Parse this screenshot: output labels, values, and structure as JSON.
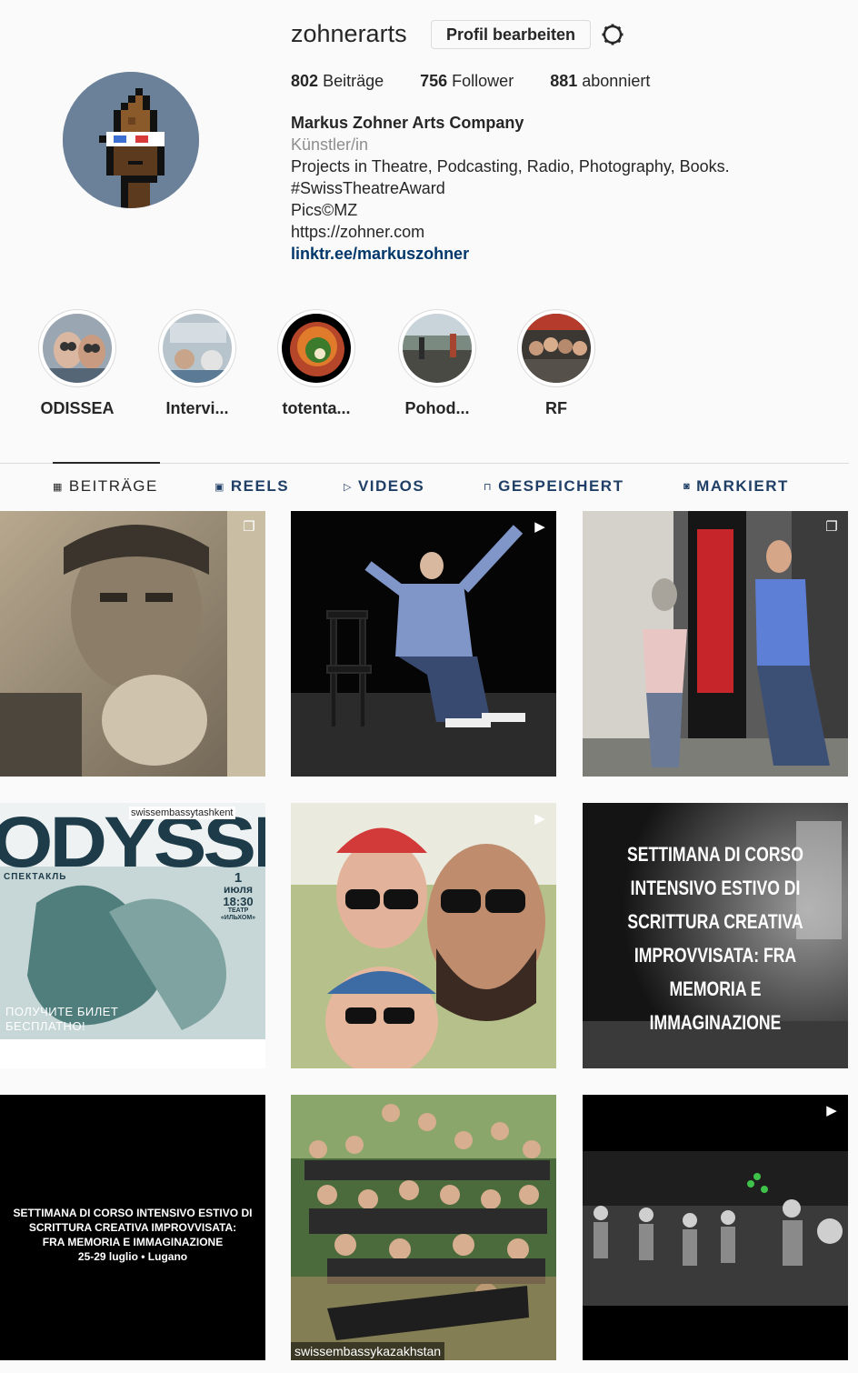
{
  "profile": {
    "username": "zohnerarts",
    "edit_label": "Profil bearbeiten",
    "stats": {
      "posts": "802",
      "posts_label": "Beiträge",
      "followers": "756",
      "followers_label": "Follower",
      "following": "881",
      "following_label": "abonniert"
    },
    "bio": {
      "name": "Markus Zohner Arts Company",
      "category": "Künstler/in",
      "line1": "Projects in Theatre, Podcasting, Radio, Photography, Books.",
      "line2": "#SwissTheatreAward",
      "line3": "Pics©MZ",
      "line4": "https://zohner.com",
      "link": "linktr.ee/markuszohner"
    }
  },
  "highlights": [
    {
      "label": "ODISSEA"
    },
    {
      "label": "Intervi..."
    },
    {
      "label": "totenta..."
    },
    {
      "label": "Pohod..."
    },
    {
      "label": "RF"
    }
  ],
  "tabs": [
    {
      "label": "BEITRÄGE",
      "icon": "grid-icon",
      "active": true
    },
    {
      "label": "REELS",
      "icon": "reels-icon"
    },
    {
      "label": "VIDEOS",
      "icon": "play-icon"
    },
    {
      "label": "GESPEICHERT",
      "icon": "bookmark-icon"
    },
    {
      "label": "MARKIERT",
      "icon": "tag-user-icon"
    }
  ],
  "posts": {
    "p4": {
      "handle": "swissembassytashkent",
      "title": "ODYSSE",
      "kind": "СПЕКТАКЛЬ",
      "day": "1",
      "month": "июля",
      "time": "18:30",
      "venue": "ТЕАТР «ИЛЬХОМ»",
      "promo_1": "ПОЛУЧИТЕ БИЛЕТ",
      "promo_2": "БЕСПЛАТНО!"
    },
    "p6": {
      "l1": "SETTIMANA DI CORSO",
      "l2": "INTENSIVO ESTIVO DI",
      "l3": "SCRITTURA CREATIVA",
      "l4": "IMPROVVISATA: FRA",
      "l5": "MEMORIA E",
      "l6": "IMMAGINAZIONE"
    },
    "p7": {
      "l1": "SETTIMANA DI CORSO INTENSIVO ESTIVO DI",
      "l2": "SCRITTURA CREATIVA IMPROVVISATA:",
      "l3": "FRA MEMORIA E IMMAGINAZIONE",
      "l4": "25-29 luglio • Lugano"
    },
    "p8": {
      "caption": "swissembassykazakhstan"
    }
  },
  "colors": {
    "link": "#00376b",
    "tab_text": "#1f3f66",
    "muted": "#8e8e8e"
  }
}
